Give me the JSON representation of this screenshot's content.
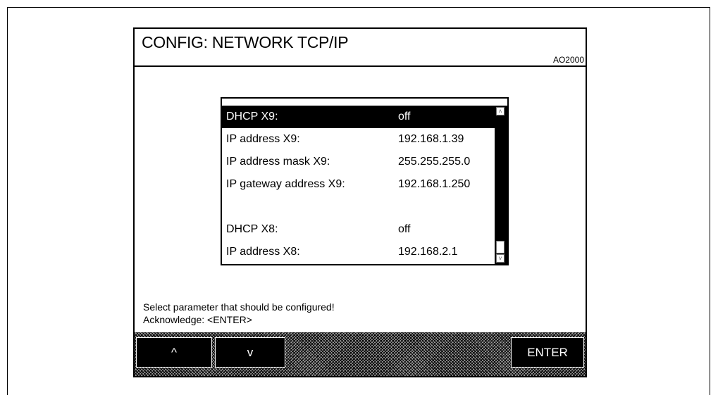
{
  "screen": {
    "title": "CONFIG: NETWORK TCP/IP",
    "model": "AO2000"
  },
  "list": {
    "rows": [
      {
        "label": "DHCP X9:",
        "value": "off",
        "selected": true
      },
      {
        "label": "IP address X9:",
        "value": "192.168.1.39"
      },
      {
        "label": "IP address mask X9:",
        "value": "255.255.255.0"
      },
      {
        "label": "IP gateway address X9:",
        "value": "192.168.1.250"
      },
      {
        "label": "",
        "value": ""
      },
      {
        "label": "DHCP X8:",
        "value": "off"
      },
      {
        "label": "IP address X8:",
        "value": "192.168.2.1"
      }
    ],
    "scroll_up_glyph": "˄",
    "scroll_down_glyph": "˅"
  },
  "status": {
    "line1": "Select parameter that should be configured!",
    "line2": "Acknowledge: <ENTER>"
  },
  "softkeys": {
    "up": "^",
    "down": "v",
    "enter": "ENTER"
  }
}
